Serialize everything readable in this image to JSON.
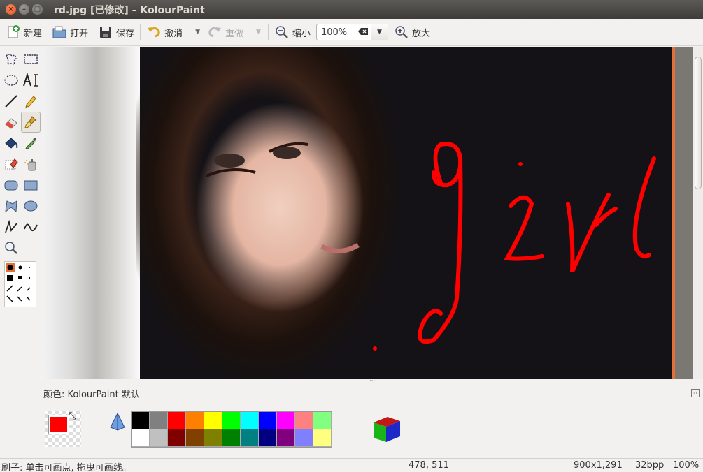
{
  "window": {
    "title": "rd.jpg [已修改] – KolourPaint",
    "close_glyph": "×",
    "min_glyph": "–",
    "max_glyph": "□"
  },
  "toolbar": {
    "new_label": "新建",
    "open_label": "打开",
    "save_label": "保存",
    "undo_label": "撤消",
    "redo_label": "重做",
    "zoom_out_label": "缩小",
    "zoom_value": "100%",
    "zoom_in_label": "放大",
    "dropdown_glyph": "▼"
  },
  "tools": [
    {
      "name": "free-form-select-icon"
    },
    {
      "name": "rect-select-icon"
    },
    {
      "name": "ellipse-select-icon"
    },
    {
      "name": "text-icon"
    },
    {
      "name": "line-icon"
    },
    {
      "name": "pen-icon"
    },
    {
      "name": "eraser-icon"
    },
    {
      "name": "brush-icon"
    },
    {
      "name": "flood-fill-icon"
    },
    {
      "name": "color-picker-icon"
    },
    {
      "name": "color-eraser-icon"
    },
    {
      "name": "spraycan-icon"
    },
    {
      "name": "rounded-rect-icon"
    },
    {
      "name": "rectangle-icon"
    },
    {
      "name": "polygon-icon"
    },
    {
      "name": "ellipse-icon"
    },
    {
      "name": "connected-lines-icon"
    },
    {
      "name": "curve-icon"
    },
    {
      "name": "zoom-tool-icon"
    }
  ],
  "colors": {
    "label": "颜色: KolourPaint 默认",
    "foreground": "#ff0000",
    "background": "#ffffff",
    "palette_row1": [
      "#000000",
      "#808080",
      "#ff0000",
      "#ff8000",
      "#ffff00",
      "#00ff00",
      "#00ffff",
      "#0000ff",
      "#ff00ff",
      "#ff8080",
      "#80ff80"
    ],
    "palette_row2": [
      "#ffffff",
      "#c0c0c0",
      "#800000",
      "#804000",
      "#808000",
      "#008000",
      "#008080",
      "#000080",
      "#800080",
      "#8080ff",
      "#ffff80"
    ],
    "accent": "#e46f3b"
  },
  "status": {
    "hint": "刷子: 单击可画点, 拖曳可画线。",
    "coords": "478, 511",
    "size": "900x1,291",
    "depth": "32bpp",
    "zoom": "100%"
  }
}
